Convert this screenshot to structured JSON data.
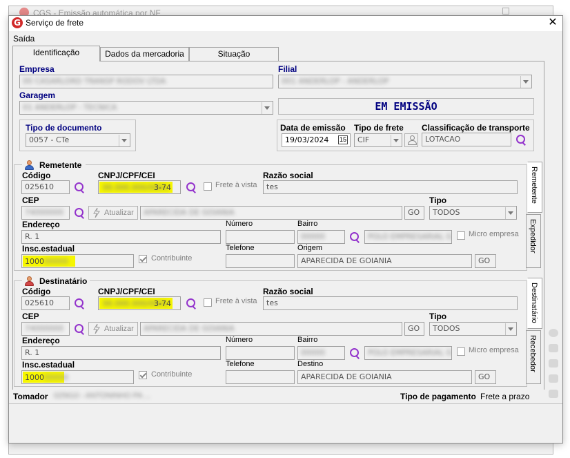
{
  "background_window": {
    "title": "CGS - Emissão automática por NF"
  },
  "window": {
    "title": "Serviço de frete",
    "logo_letter": "G"
  },
  "menu": {
    "saida": "Saída"
  },
  "tabs": [
    {
      "label": "Identificação"
    },
    {
      "label": "Dados da mercadoria"
    },
    {
      "label": "Situação"
    }
  ],
  "identificacao": {
    "empresa_label": "Empresa",
    "empresa_value": "00 CASARLORD TRANSP RODOV LTDA",
    "filial_label": "Filial",
    "filial_value": "001 ANDERLOP - ANDERLOP",
    "garagem_label": "Garagem",
    "garagem_value": "01 ANDERLOP - TECNICA",
    "status": "EM EMISSÃO",
    "tipo_documento_label": "Tipo de documento",
    "tipo_documento_value": "0057 - CTe",
    "data_emissao_label": "Data de emissão",
    "data_emissao_value": "19/03/2024",
    "calendar_day": "15",
    "tipo_frete_label": "Tipo de frete",
    "tipo_frete_value": "CIF",
    "classificacao_label": "Classificação de transporte",
    "classificacao_value": "LOTACAO"
  },
  "remetente": {
    "title": "Remetente",
    "codigo_label": "Código",
    "codigo_value": "025610",
    "cnpj_label": "CNPJ/CPF/CEI",
    "cnpj_hidden": "00.000.000/0001-",
    "cnpj_suffix": "3-74",
    "frete_vista_label": "Frete à vista",
    "razao_label": "Razão social",
    "razao_value": "tes",
    "cep_label": "CEP",
    "cep_value": "74000000",
    "atualizar_label": "Atualizar",
    "cidade_value": "APARECIDA DE GOIANIA",
    "uf_value": "GO",
    "tipo_label": "Tipo",
    "tipo_value": "TODOS",
    "endereco_label": "Endereço",
    "endereco_value": "R. 1",
    "numero_label": "Número",
    "bairro_label": "Bairro",
    "bairro_code": "00000",
    "bairro_value": "POLO EMPRESARIAL G",
    "micro_empresa_label": "Micro empresa",
    "insc_label": "Insc.estadual",
    "insc_value": "1000",
    "insc_hidden": "00000",
    "contribuinte_label": "Contribuinte",
    "telefone_label": "Telefone",
    "origem_label": "Origem",
    "origem_value": "APARECIDA DE GOIANIA",
    "origem_uf": "GO"
  },
  "destinatario": {
    "title": "Destinatário",
    "codigo_label": "Código",
    "codigo_value": "025610",
    "cnpj_label": "CNPJ/CPF/CEI",
    "cnpj_hidden": "00.000.000/0001-",
    "cnpj_suffix": "3-74",
    "frete_vista_label": "Frete à vista",
    "razao_label": "Razão social",
    "razao_value": "tes",
    "cep_label": "CEP",
    "cep_value": "74000000",
    "atualizar_label": "Atualizar",
    "cidade_value": "APARECIDA DE GOIANIA",
    "uf_value": "GO",
    "tipo_label": "Tipo",
    "tipo_value": "TODOS",
    "endereco_label": "Endereço",
    "endereco_value": "R. 1",
    "numero_label": "Número",
    "bairro_label": "Bairro",
    "bairro_code": "00000",
    "bairro_value": "POLO EMPRESARIAL G",
    "micro_empresa_label": "Micro empresa",
    "insc_label": "Insc.estadual",
    "insc_value": "1000",
    "insc_hidden": "00000",
    "contribuinte_label": "Contribuinte",
    "telefone_label": "Telefone",
    "destino_label": "Destino",
    "destino_value": "APARECIDA DE GOIANIA",
    "destino_uf": "GO"
  },
  "side_tabs": {
    "remetente": "Remetente",
    "expedidor": "Expedidor",
    "destinatario": "Destinatário",
    "recebedor": "Recebedor"
  },
  "footer": {
    "tomador_label": "Tomador",
    "tomador_value": "025610 - ANTONINHO PA ...",
    "tipo_pagamento_label": "Tipo de pagamento",
    "tipo_pagamento_value": "Frete a prazo"
  },
  "colors": {
    "highlight": "#f6f600",
    "accent": "#9333cc",
    "navy": "#000080",
    "logo": "#d12a2a"
  }
}
